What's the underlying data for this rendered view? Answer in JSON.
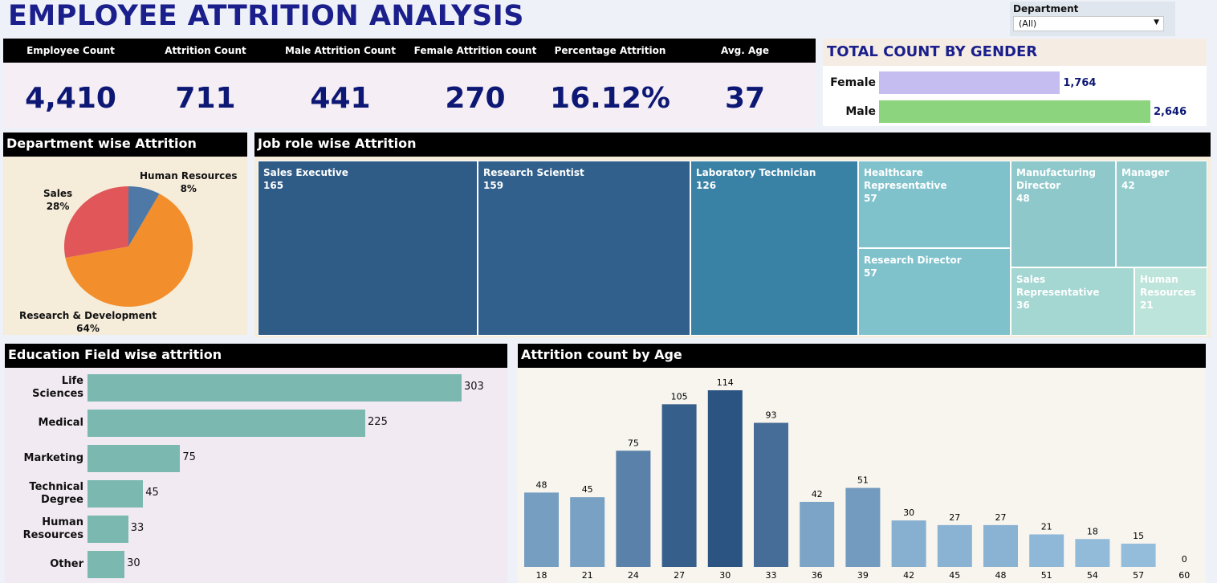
{
  "title": "EMPLOYEE ATTRITION ANALYSIS",
  "filter": {
    "label": "Department",
    "value": "(All)"
  },
  "kpis": [
    {
      "label": "Employee Count",
      "value": "4,410"
    },
    {
      "label": "Attrition Count",
      "value": "711"
    },
    {
      "label": "Male Attrition Count",
      "value": "441"
    },
    {
      "label": "Female Attrition count",
      "value": "270"
    },
    {
      "label": "Percentage Attrition",
      "value": "16.12%"
    },
    {
      "label": "Avg. Age",
      "value": "37"
    }
  ],
  "colors": {
    "female": "#c5bcf0",
    "male": "#8dd47e",
    "sales": "#e15759",
    "rnd": "#f28e2b",
    "hr": "#4e79a7",
    "edu_bar": "#7ab8b0"
  },
  "chart_data": [
    {
      "type": "bar",
      "title": "TOTAL COUNT BY GENDER",
      "categories": [
        "Female",
        "Male"
      ],
      "values": [
        1764,
        2646
      ],
      "value_labels": [
        "1,764",
        "2,646"
      ]
    },
    {
      "type": "pie",
      "title": "Department wise Attrition",
      "categories": [
        "Human Resources",
        "Research & Development",
        "Sales"
      ],
      "values": [
        8,
        64,
        28
      ],
      "value_labels": [
        "8%",
        "64%",
        "28%"
      ]
    },
    {
      "type": "treemap",
      "title": "Job role wise Attrition",
      "categories": [
        "Sales Executive",
        "Research Scientist",
        "Laboratory Technician",
        "Healthcare Representative",
        "Research Director",
        "Manufacturing Director",
        "Manager",
        "Sales Representative",
        "Human Resources"
      ],
      "values": [
        165,
        159,
        126,
        57,
        57,
        48,
        42,
        36,
        21
      ]
    },
    {
      "type": "bar",
      "title": "Education Field wise attrition",
      "categories": [
        "Life Sciences",
        "Medical",
        "Marketing",
        "Technical Degree",
        "Human Resources",
        "Other"
      ],
      "values": [
        303,
        225,
        75,
        45,
        33,
        30
      ]
    },
    {
      "type": "bar",
      "title": "Attrition count by Age",
      "categories": [
        "18",
        "21",
        "24",
        "27",
        "30",
        "33",
        "36",
        "39",
        "42",
        "45",
        "48",
        "51",
        "54",
        "57",
        "60"
      ],
      "values": [
        48,
        45,
        75,
        105,
        114,
        93,
        42,
        51,
        30,
        27,
        27,
        21,
        18,
        15,
        0
      ]
    }
  ]
}
